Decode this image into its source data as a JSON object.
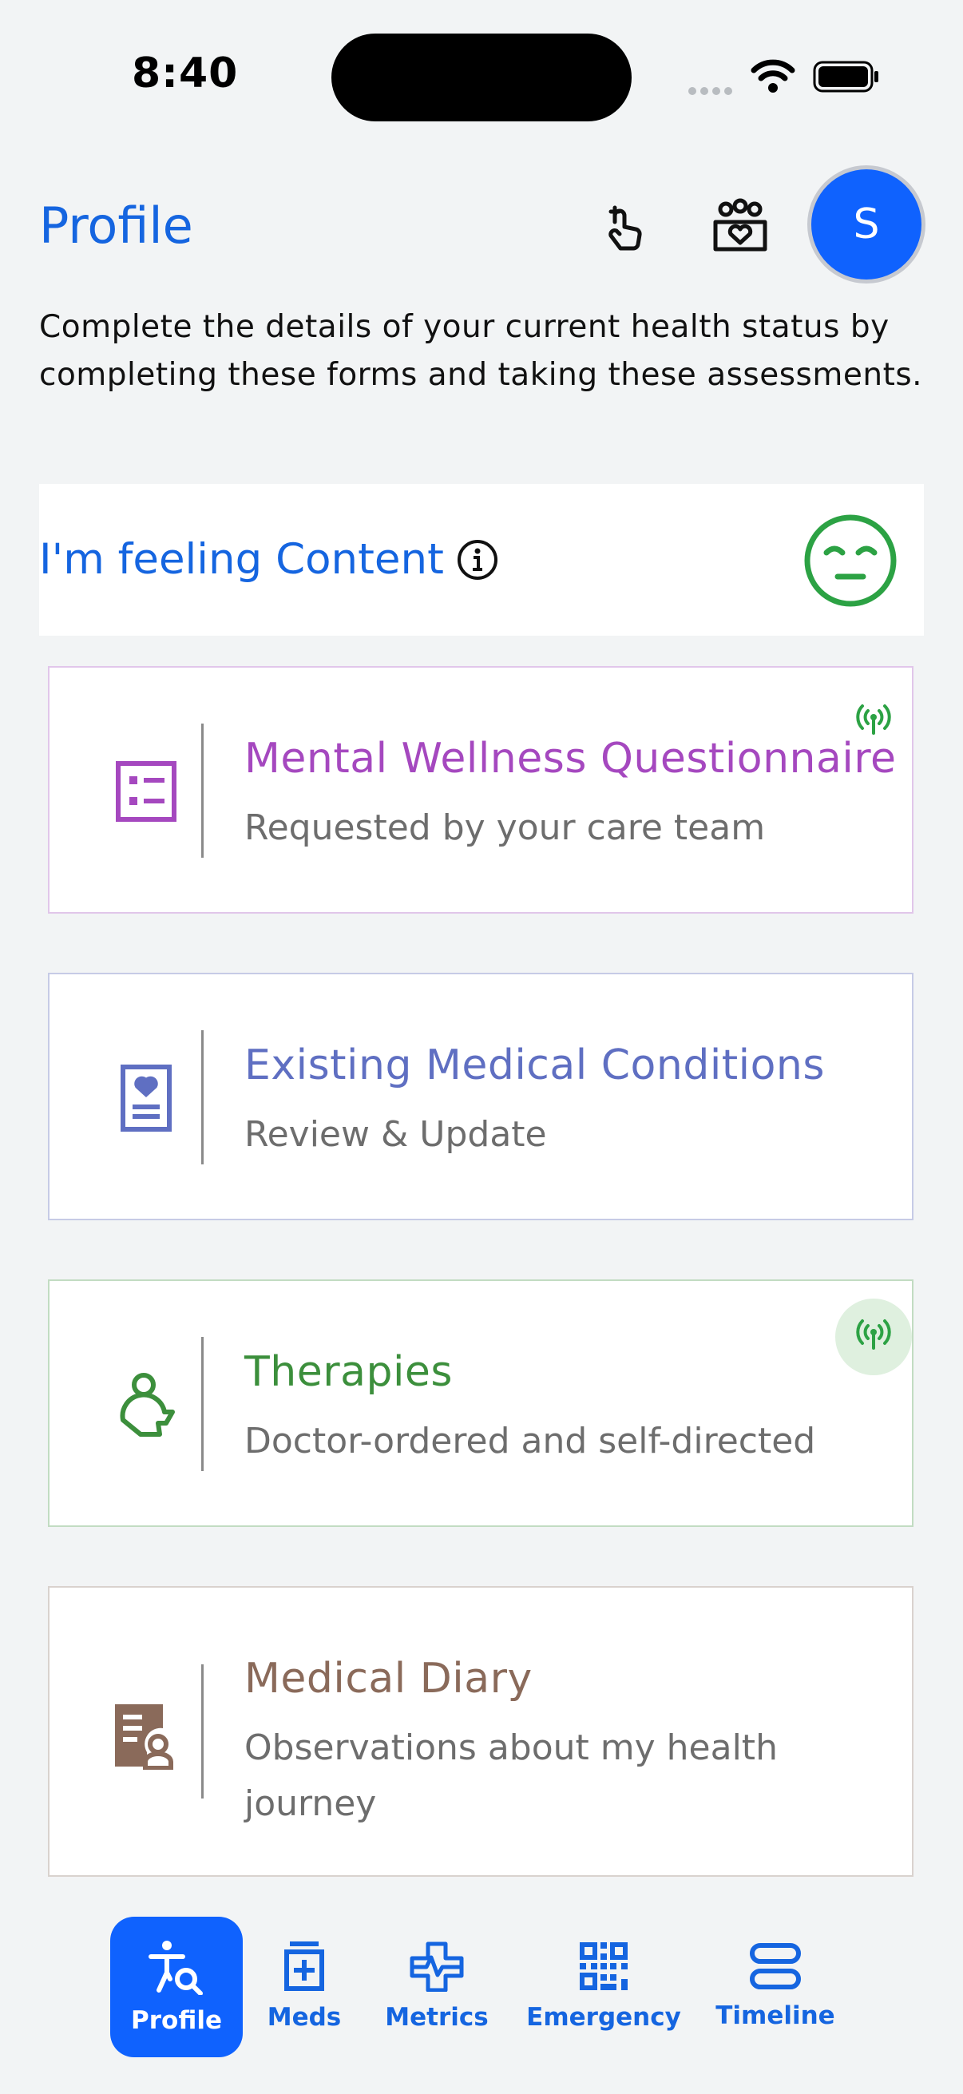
{
  "status_bar": {
    "time": "8:40"
  },
  "header": {
    "title": "Profile",
    "avatar_initial": "S"
  },
  "intro_text": "Complete the details of your current health status by completing these forms and taking these assessments.",
  "feeling": {
    "label": "I'm feeling Content",
    "color": "#2ca244"
  },
  "cards": [
    {
      "title": "Mental Wellness Questionnaire",
      "subtitle": "Requested by your care team",
      "color": "#a548bf",
      "icon": "list-form-icon"
    },
    {
      "title": "Existing Medical Conditions",
      "subtitle": "Review & Update",
      "color": "#5f6fc2",
      "icon": "medical-record-icon"
    },
    {
      "title": "Therapies",
      "subtitle": "Doctor-ordered and self-directed",
      "color": "#3c8f3c",
      "icon": "therapy-person-icon"
    },
    {
      "title": "Medical Diary",
      "subtitle": "Observations about my health journey",
      "color": "#8a6a5a",
      "icon": "diary-icon"
    }
  ],
  "nav": [
    {
      "label": "Profile",
      "icon": "profile-search-icon",
      "active": true
    },
    {
      "label": "Meds",
      "icon": "meds-icon",
      "active": false
    },
    {
      "label": "Metrics",
      "icon": "metrics-icon",
      "active": false
    },
    {
      "label": "Emergency",
      "icon": "qr-code-icon",
      "active": false
    },
    {
      "label": "Timeline",
      "icon": "timeline-icon",
      "active": false
    }
  ],
  "colors": {
    "accent": "#1565e0",
    "active_nav": "#0f62fe",
    "background": "#f2f4f5"
  }
}
